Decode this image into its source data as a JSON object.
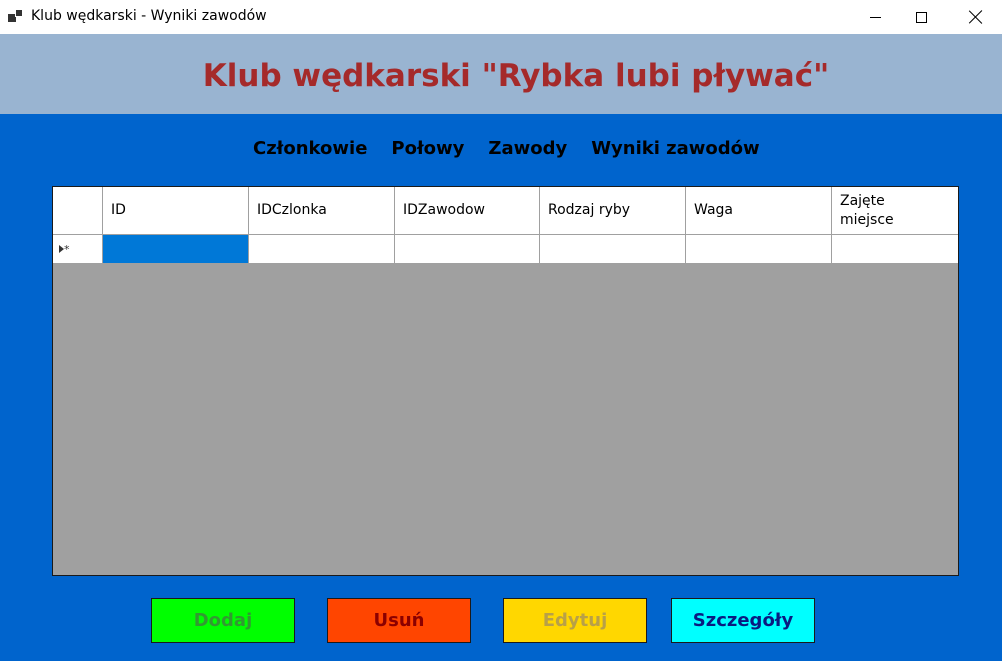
{
  "window": {
    "title": "Klub wędkarski - Wyniki zawodów",
    "icons": {
      "app": "app-icon",
      "minimize": "minimize-icon",
      "maximize": "maximize-icon",
      "close": "close-icon"
    }
  },
  "header": {
    "title": "Klub wędkarski \"Rybka lubi pływać\"",
    "title_color": "#a52a2a",
    "background": "#99b4d1"
  },
  "menu": {
    "items": [
      {
        "label": "Członkowie"
      },
      {
        "label": "Połowy"
      },
      {
        "label": "Zawody"
      },
      {
        "label": "Wyniki zawodów"
      }
    ]
  },
  "grid": {
    "columns": [
      "ID",
      "IDCzlonka",
      "IDZawodow",
      "Rodzaj ryby",
      "Waga",
      "Zajęte\nmiejsce"
    ],
    "new_row_marker": "▸*",
    "rows": [
      [
        "",
        "",
        "",
        "",
        "",
        ""
      ]
    ],
    "selection_color": "#0078d7",
    "empty_area_color": "#a0a0a0"
  },
  "buttons": {
    "add": {
      "label": "Dodaj",
      "bg": "#00ff00"
    },
    "delete": {
      "label": "Usuń",
      "bg": "#ff4500"
    },
    "edit": {
      "label": "Edytuj",
      "bg": "#ffd700"
    },
    "details": {
      "label": "Szczegóły",
      "bg": "#00ffff"
    }
  },
  "colors": {
    "main_background": "#0064cd"
  }
}
